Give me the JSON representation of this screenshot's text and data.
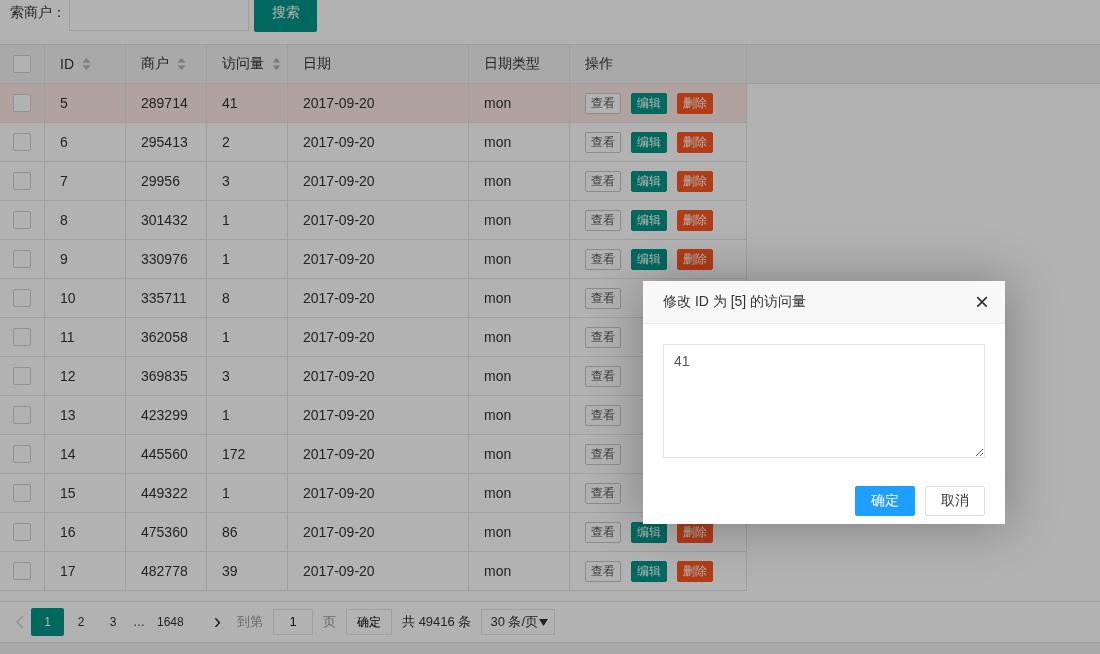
{
  "search": {
    "label": "索商户：",
    "button": "搜索"
  },
  "table": {
    "header_checkbox": {
      "checked": false
    },
    "columns": [
      {
        "label": "ID",
        "sortable": true
      },
      {
        "label": "商户",
        "sortable": true
      },
      {
        "label": "访问量",
        "sortable": true
      },
      {
        "label": "日期",
        "sortable": false
      },
      {
        "label": "日期类型",
        "sortable": false
      },
      {
        "label": "操作",
        "sortable": false
      }
    ],
    "rows": [
      {
        "checked": false,
        "selected": true,
        "cells": [
          "5",
          "289714",
          "41",
          "2017-09-20",
          "mon"
        ],
        "actions": [
          {
            "kind": "view",
            "label": "查看"
          },
          {
            "kind": "edit",
            "label": "编辑"
          },
          {
            "kind": "delete",
            "label": "删除"
          }
        ]
      },
      {
        "checked": false,
        "selected": false,
        "cells": [
          "6",
          "295413",
          "2",
          "2017-09-20",
          "mon"
        ],
        "actions": [
          {
            "kind": "view",
            "label": "查看"
          },
          {
            "kind": "edit",
            "label": "编辑"
          },
          {
            "kind": "delete",
            "label": "删除"
          }
        ]
      },
      {
        "checked": false,
        "selected": false,
        "cells": [
          "7",
          "29956",
          "3",
          "2017-09-20",
          "mon"
        ],
        "actions": [
          {
            "kind": "view",
            "label": "查看"
          },
          {
            "kind": "edit",
            "label": "编辑"
          },
          {
            "kind": "delete",
            "label": "删除"
          }
        ]
      },
      {
        "checked": false,
        "selected": false,
        "cells": [
          "8",
          "301432",
          "1",
          "2017-09-20",
          "mon"
        ],
        "actions": [
          {
            "kind": "view",
            "label": "查看"
          },
          {
            "kind": "edit",
            "label": "编辑"
          },
          {
            "kind": "delete",
            "label": "删除"
          }
        ]
      },
      {
        "checked": false,
        "selected": false,
        "cells": [
          "9",
          "330976",
          "1",
          "2017-09-20",
          "mon"
        ],
        "actions": [
          {
            "kind": "view",
            "label": "查看"
          },
          {
            "kind": "edit",
            "label": "编辑"
          },
          {
            "kind": "delete",
            "label": "删除"
          }
        ]
      },
      {
        "checked": false,
        "selected": false,
        "cells": [
          "10",
          "335711",
          "8",
          "2017-09-20",
          "mon"
        ],
        "actions": [
          {
            "kind": "view",
            "label": "查看"
          }
        ]
      },
      {
        "checked": false,
        "selected": false,
        "cells": [
          "11",
          "362058",
          "1",
          "2017-09-20",
          "mon"
        ],
        "actions": [
          {
            "kind": "view",
            "label": "查看"
          }
        ]
      },
      {
        "checked": false,
        "selected": false,
        "cells": [
          "12",
          "369835",
          "3",
          "2017-09-20",
          "mon"
        ],
        "actions": [
          {
            "kind": "view",
            "label": "查看"
          }
        ]
      },
      {
        "checked": false,
        "selected": false,
        "cells": [
          "13",
          "423299",
          "1",
          "2017-09-20",
          "mon"
        ],
        "actions": [
          {
            "kind": "view",
            "label": "查看"
          }
        ]
      },
      {
        "checked": false,
        "selected": false,
        "cells": [
          "14",
          "445560",
          "172",
          "2017-09-20",
          "mon"
        ],
        "actions": [
          {
            "kind": "view",
            "label": "查看"
          }
        ]
      },
      {
        "checked": false,
        "selected": false,
        "cells": [
          "15",
          "449322",
          "1",
          "2017-09-20",
          "mon"
        ],
        "actions": [
          {
            "kind": "view",
            "label": "查看"
          }
        ]
      },
      {
        "checked": false,
        "selected": false,
        "cells": [
          "16",
          "475360",
          "86",
          "2017-09-20",
          "mon"
        ],
        "actions": [
          {
            "kind": "view",
            "label": "查看"
          },
          {
            "kind": "edit",
            "label": "编辑"
          },
          {
            "kind": "delete",
            "label": "删除"
          }
        ]
      },
      {
        "checked": false,
        "selected": false,
        "cells": [
          "17",
          "482778",
          "39",
          "2017-09-20",
          "mon"
        ],
        "actions": [
          {
            "kind": "view",
            "label": "查看"
          },
          {
            "kind": "edit",
            "label": "编辑"
          },
          {
            "kind": "delete",
            "label": "删除"
          }
        ]
      }
    ]
  },
  "pagination": {
    "prev_disabled": true,
    "pages": [
      {
        "label": "1",
        "selected": true
      },
      {
        "label": "2",
        "selected": false
      },
      {
        "label": "3",
        "selected": false
      }
    ],
    "ellipsis": "…",
    "last": "1648",
    "next": "›",
    "goto_label": "到第",
    "goto_value": "1",
    "page_unit": "页",
    "confirm": "确定",
    "total": "共 49416 条",
    "page_size": "30 条/页"
  },
  "dialog": {
    "title": "修改 ID 为 [5] 的访问量",
    "close": "×",
    "value": "41",
    "buttons": [
      {
        "kind": "primary",
        "label": "确定"
      },
      {
        "kind": "default",
        "label": "取消"
      }
    ]
  }
}
